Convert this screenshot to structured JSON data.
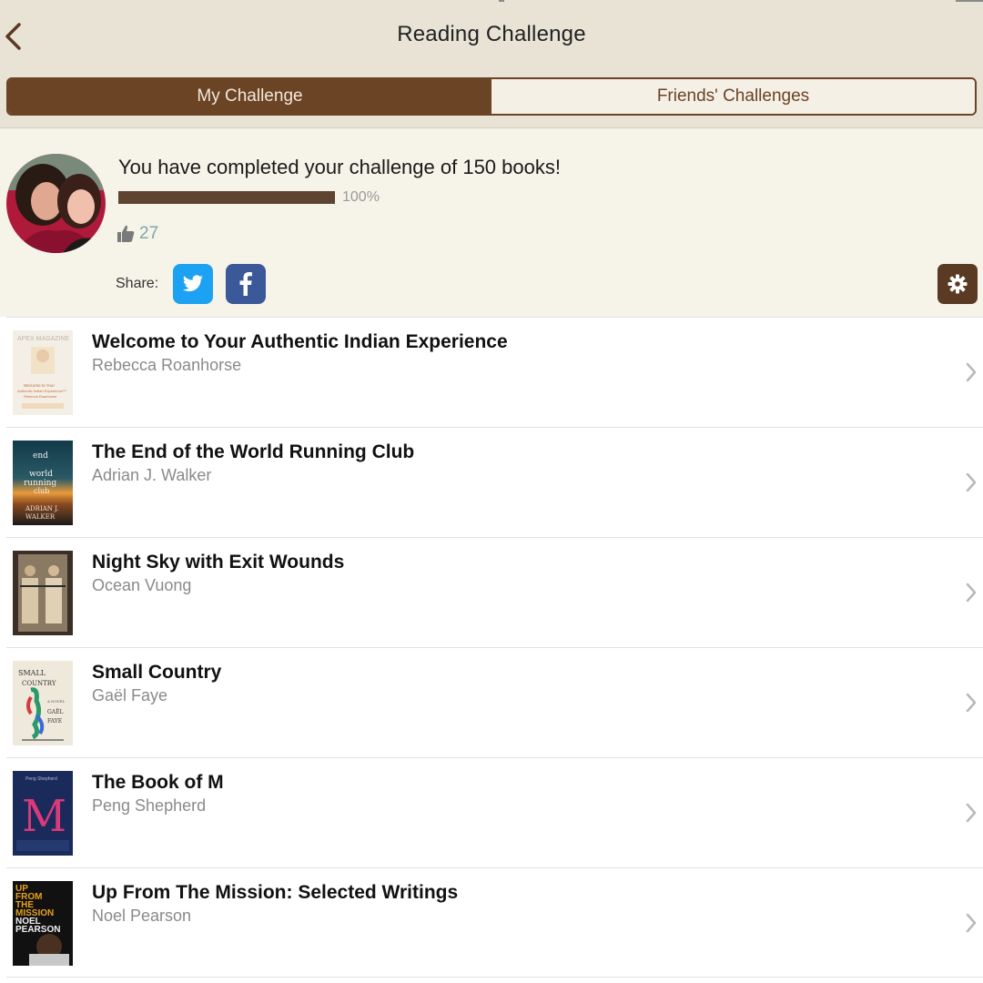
{
  "header": {
    "title": "Reading Challenge",
    "back_icon": "chevron-left-icon"
  },
  "tabs": [
    {
      "label": "My Challenge",
      "active": true
    },
    {
      "label": "Friends' Challenges",
      "active": false
    }
  ],
  "summary": {
    "message": "You have completed your challenge of 150 books!",
    "progress_fraction": 1.0,
    "progress_label": "100%",
    "likes": "27",
    "share_label": "Share:"
  },
  "colors": {
    "accent_brown": "#6b4325",
    "twitter_blue": "#1da1f2",
    "facebook_blue": "#3b5998",
    "likes_teal": "#7fa8a6"
  },
  "books": [
    {
      "title": "Welcome to Your Authentic Indian Experience",
      "author": "Rebecca Roanhorse"
    },
    {
      "title": "The End of the World Running Club",
      "author": "Adrian J. Walker"
    },
    {
      "title": "Night Sky with Exit Wounds",
      "author": "Ocean Vuong"
    },
    {
      "title": "Small Country",
      "author": "Gaël Faye"
    },
    {
      "title": "The Book of M",
      "author": "Peng Shepherd"
    },
    {
      "title": "Up From The Mission: Selected Writings",
      "author": "Noel Pearson"
    }
  ],
  "covers": [
    {
      "text_lines": [
        "APEX MAGAZINE",
        "Welcome to Your",
        "Authentic Indian Experience™",
        "Rebecca Roanhorse"
      ]
    },
    {
      "text_lines": [
        "end",
        "world",
        "running",
        "club",
        "ADRIAN J.",
        "WALKER"
      ]
    },
    {
      "text_lines": []
    },
    {
      "text_lines": [
        "SMALL",
        "COUNTRY",
        "A NOVEL",
        "GAËL",
        "FAYE"
      ]
    },
    {
      "text_lines": [
        "Peng Shepherd",
        "M"
      ]
    },
    {
      "text_lines": [
        "UP",
        "FROM",
        "THE",
        "MISSION",
        "NOEL",
        "PEARSON"
      ]
    }
  ]
}
